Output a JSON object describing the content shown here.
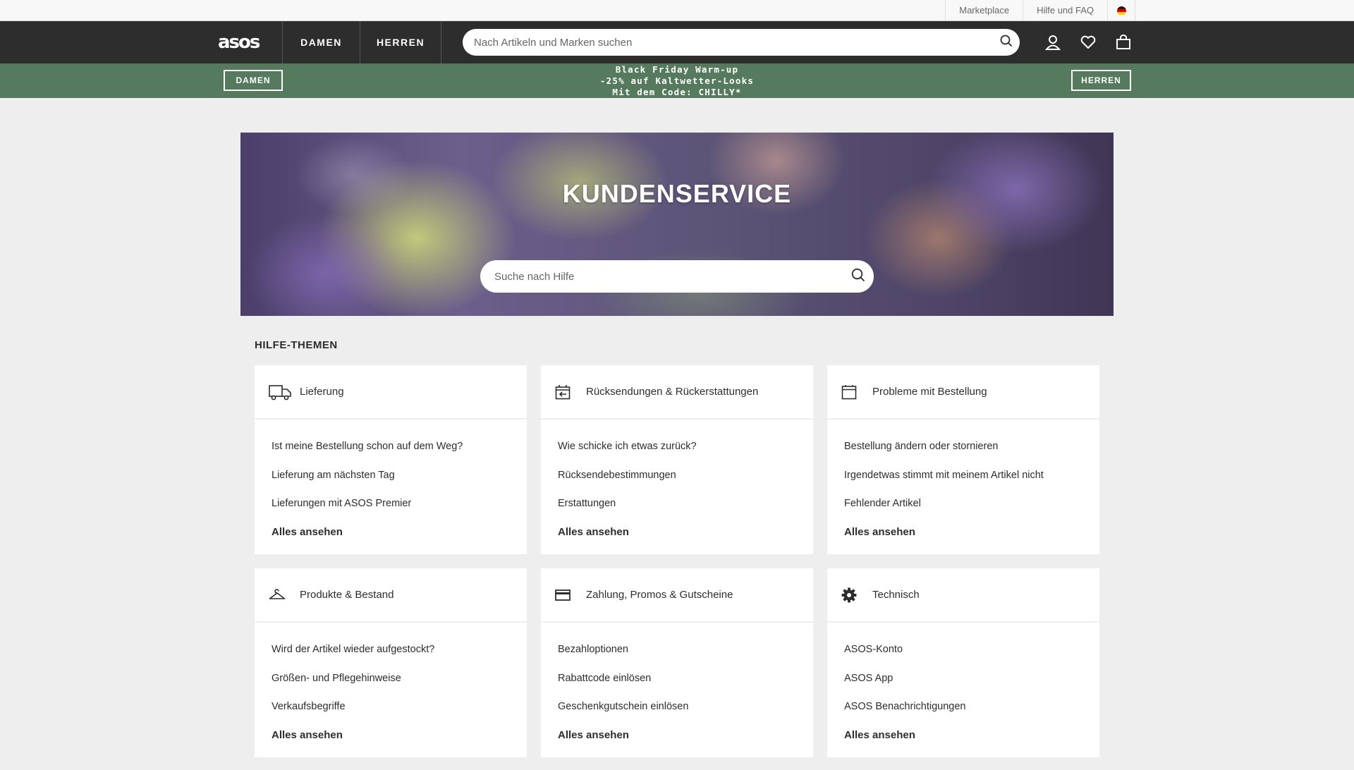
{
  "utility": {
    "marketplace": "Marketplace",
    "help": "Hilfe und FAQ"
  },
  "nav": {
    "logo": "asos",
    "tabs": [
      "DAMEN",
      "HERREN"
    ],
    "search_placeholder": "Nach Artikeln und Marken suchen"
  },
  "promo": {
    "left_button": "DAMEN",
    "right_button": "HERREN",
    "line1": "Black Friday Warm-up",
    "line2": "-25% auf Kaltwetter-Looks",
    "line3": "Mit dem Code: CHILLY*"
  },
  "hero": {
    "title": "KUNDENSERVICE",
    "search_placeholder": "Suche nach Hilfe"
  },
  "topics_title": "HILFE-THEMEN",
  "topics": [
    {
      "icon": "truck-icon",
      "title": "Lieferung",
      "links": [
        "Ist meine Bestellung schon auf dem Weg?",
        "Lieferung am nächsten Tag",
        "Lieferungen mit ASOS Premier"
      ],
      "all": "Alles ansehen"
    },
    {
      "icon": "return-box-icon",
      "title": "Rücksendungen & Rückerstattungen",
      "links": [
        "Wie schicke ich etwas zurück?",
        "Rücksendebestimmungen",
        "Erstattungen"
      ],
      "all": "Alles ansehen"
    },
    {
      "icon": "order-box-icon",
      "title": "Probleme mit Bestellung",
      "links": [
        "Bestellung ändern oder stornieren",
        "Irgendetwas stimmt mit meinem Artikel nicht",
        "Fehlender Artikel"
      ],
      "all": "Alles ansehen"
    },
    {
      "icon": "hanger-icon",
      "title": "Produkte & Bestand",
      "links": [
        "Wird der Artikel wieder aufgestockt?",
        "Größen- und Pflegehinweise",
        "Verkaufsbegriffe"
      ],
      "all": "Alles ansehen"
    },
    {
      "icon": "credit-card-icon",
      "title": "Zahlung, Promos & Gutscheine",
      "links": [
        "Bezahloptionen",
        "Rabattcode einlösen",
        "Geschenkgutschein einlösen"
      ],
      "all": "Alles ansehen"
    },
    {
      "icon": "gear-icon",
      "title": "Technisch",
      "links": [
        "ASOS-Konto",
        "ASOS App",
        "ASOS Benachrichtigungen"
      ],
      "all": "Alles ansehen"
    }
  ],
  "colors": {
    "nav_bg": "#2d2d2d",
    "promo_bg": "#567a5e",
    "page_bg": "#eeeeee"
  }
}
